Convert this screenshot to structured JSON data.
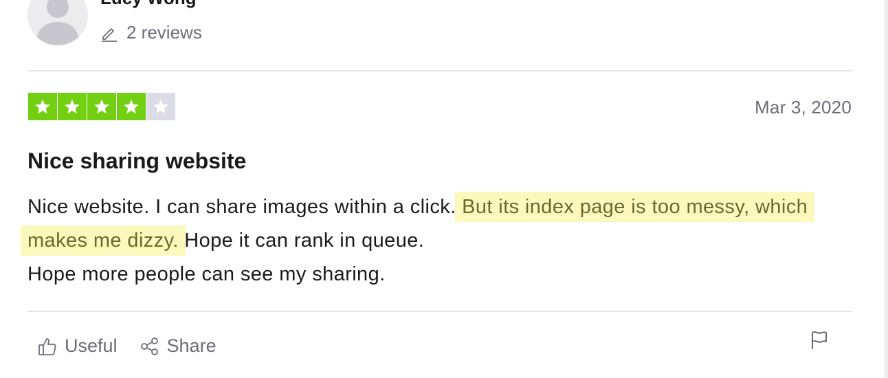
{
  "reviewer": {
    "name": "Lucy Wong",
    "reviews_count": "2 reviews"
  },
  "review": {
    "rating": 4,
    "max_rating": 5,
    "date": "Mar 3, 2020",
    "title": "Nice sharing website",
    "body_part1": "Nice website. I can share images within a click. ",
    "body_highlight": "But its index page is too messy, which makes me dizzy.",
    "body_part2": " Hope it can rank in queue.",
    "body_part3": "Hope more people can see my sharing."
  },
  "actions": {
    "useful_label": "Useful",
    "share_label": "Share"
  },
  "icons": {
    "avatar": "person-silhouette",
    "reviews": "pencil-icon",
    "useful": "thumbs-up-icon",
    "share": "share-icon",
    "report": "flag-icon",
    "star": "star-icon"
  },
  "colors": {
    "star_on": "#73cf11",
    "star_off": "#dcdce6",
    "highlight_bg": "#fdf9bd",
    "highlight_text": "#6b6a2a",
    "muted_text": "#6b6b7b"
  }
}
